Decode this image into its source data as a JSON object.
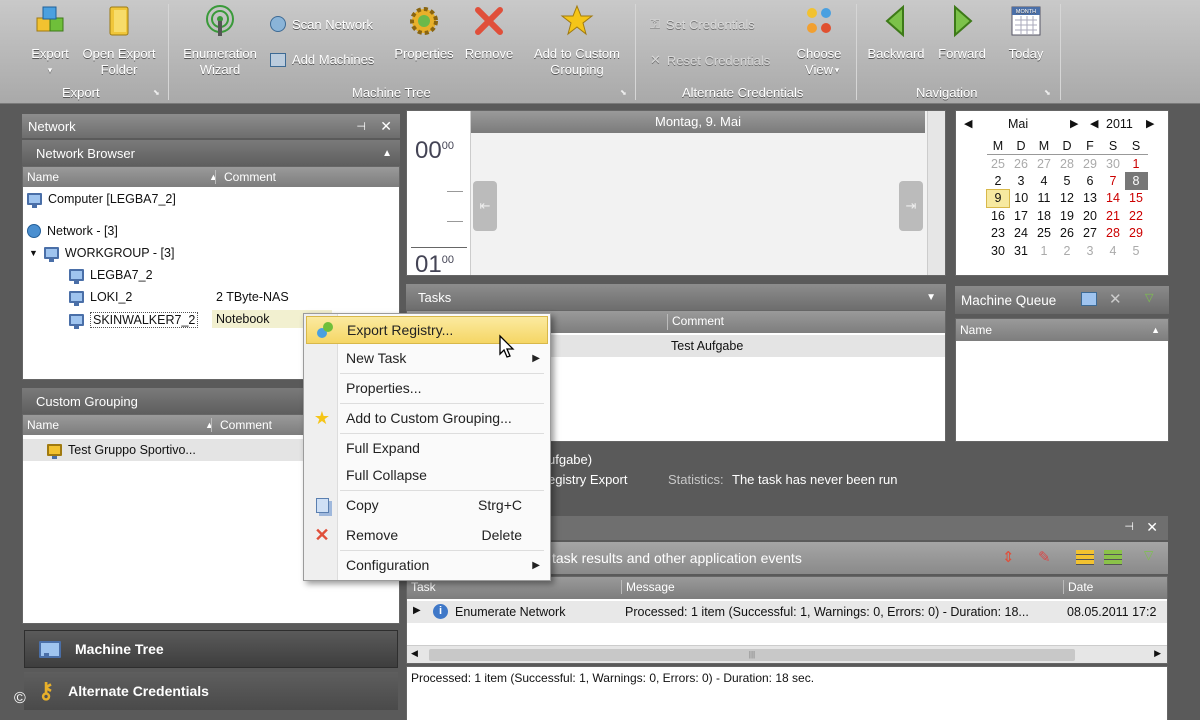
{
  "ribbon": {
    "export": "Export",
    "open_export_folder": "Open Export Folder",
    "group_export": "Export",
    "enumeration_wizard": "Enumeration Wizard",
    "scan_network": "Scan Network",
    "add_machines": "Add Machines",
    "properties": "Properties",
    "remove": "Remove",
    "add_custom_grouping": "Add to Custom Grouping",
    "group_machine_tree": "Machine Tree",
    "set_credentials": "Set Credentials",
    "reset_credentials": "Reset Credentials",
    "choose_view": "Choose View",
    "group_alt_cred": "Alternate Credentials",
    "backward": "Backward",
    "forward": "Forward",
    "today": "Today",
    "group_navigation": "Navigation",
    "month_icon_text": "MONTH"
  },
  "network": {
    "title": "Network",
    "browser_title": "Network Browser",
    "col_name": "Name",
    "col_comment": "Comment",
    "computer": "Computer [LEGBA7_2]",
    "network": "Network - [3]",
    "workgroup": "WORKGROUP - [3]",
    "machines": [
      {
        "name": "LEGBA7_2",
        "comment": ""
      },
      {
        "name": "LOKI_2",
        "comment": "2 TByte-NAS"
      },
      {
        "name": "SKINWALKER7_2",
        "comment": "Notebook"
      }
    ]
  },
  "custom_grouping": {
    "title": "Custom Grouping",
    "col_name": "Name",
    "col_comment": "Comment",
    "item": "Test Gruppo Sportivo..."
  },
  "nav": {
    "machine_tree": "Machine Tree",
    "alternate_credentials": "Alternate Credentials"
  },
  "scheduler": {
    "date_header": "Montag, 9. Mai",
    "hour0": "00",
    "min0": "00",
    "hour1": "01",
    "min1": "00"
  },
  "calendar": {
    "month": "Mai",
    "year": "2011",
    "weekdays": [
      "M",
      "D",
      "M",
      "D",
      "F",
      "S",
      "S"
    ],
    "weeks": [
      [
        "25",
        "26",
        "27",
        "28",
        "29",
        "30",
        "1"
      ],
      [
        "2",
        "3",
        "4",
        "5",
        "6",
        "7",
        "8"
      ],
      [
        "9",
        "10",
        "11",
        "12",
        "13",
        "14",
        "15"
      ],
      [
        "16",
        "17",
        "18",
        "19",
        "20",
        "21",
        "22"
      ],
      [
        "23",
        "24",
        "25",
        "26",
        "27",
        "28",
        "29"
      ],
      [
        "30",
        "31",
        "1",
        "2",
        "3",
        "4",
        "5"
      ]
    ]
  },
  "tasks": {
    "title": "Tasks",
    "col_comment": "Comment",
    "comment_value": "Test Aufgabe",
    "detail1": "ufgabe)",
    "detail2": "egistry Export",
    "stats_label": "Statistics:",
    "stats_value": "The task has never been run"
  },
  "queue": {
    "title": "Machine Queue",
    "col_name": "Name"
  },
  "log": {
    "caption": "task results and other application events",
    "col_task": "Task",
    "col_message": "Message",
    "col_date": "Date",
    "row_task": "Enumerate Network",
    "row_message": "Processed: 1 item (Successful: 1, Warnings: 0, Errors: 0) - Duration: 18...",
    "row_date": "08.05.2011 17:2",
    "scroll_center": "|||",
    "detail": "Processed: 1 item (Successful: 1, Warnings: 0, Errors: 0) - Duration: 18 sec."
  },
  "context_menu": {
    "export_registry": "Export Registry...",
    "new_task": "New Task",
    "properties": "Properties...",
    "add_custom": "Add to Custom Grouping...",
    "full_expand": "Full Expand",
    "full_collapse": "Full Collapse",
    "copy": "Copy",
    "copy_sc": "Strg+C",
    "remove": "Remove",
    "remove_sc": "Delete",
    "configuration": "Configuration"
  },
  "copyright": "©"
}
